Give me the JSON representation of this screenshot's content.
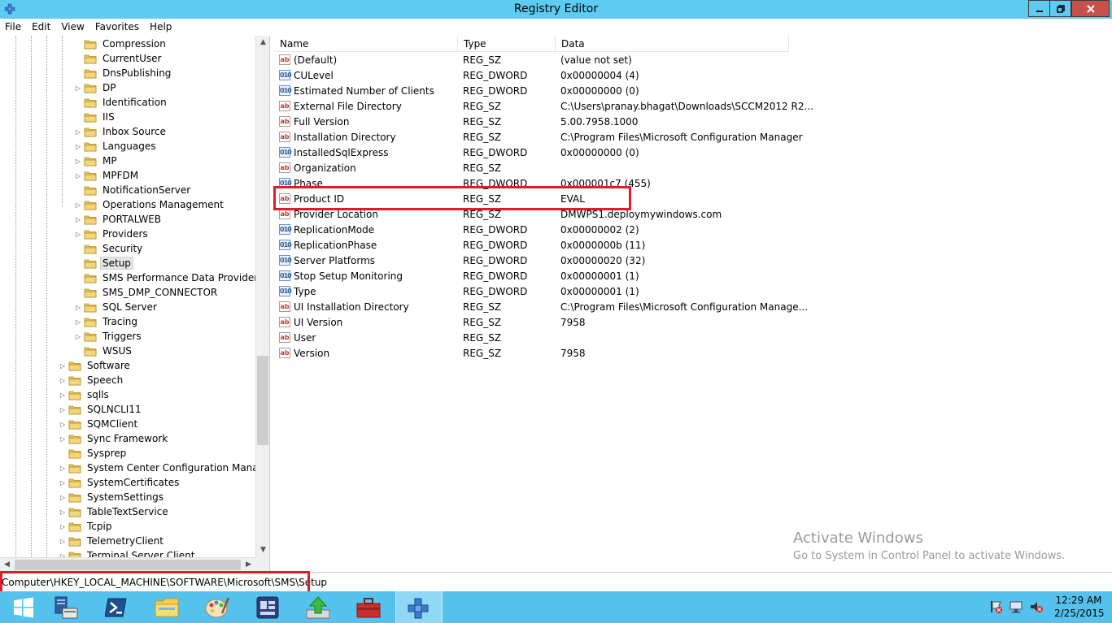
{
  "window": {
    "title": "Registry Editor",
    "buttons": {
      "minimize": "minimize-icon",
      "maximize": "restore-icon",
      "close": "close-icon"
    }
  },
  "menu": [
    "File",
    "Edit",
    "View",
    "Favorites",
    "Help"
  ],
  "tree": {
    "rows": [
      {
        "label": "Compression",
        "level": 2,
        "arrow": false,
        "selected": false
      },
      {
        "label": "CurrentUser",
        "level": 2,
        "arrow": false,
        "selected": false
      },
      {
        "label": "DnsPublishing",
        "level": 2,
        "arrow": false,
        "selected": false
      },
      {
        "label": "DP",
        "level": 2,
        "arrow": true,
        "selected": false
      },
      {
        "label": "Identification",
        "level": 2,
        "arrow": false,
        "selected": false
      },
      {
        "label": "IIS",
        "level": 2,
        "arrow": false,
        "selected": false
      },
      {
        "label": "Inbox Source",
        "level": 2,
        "arrow": true,
        "selected": false
      },
      {
        "label": "Languages",
        "level": 2,
        "arrow": true,
        "selected": false
      },
      {
        "label": "MP",
        "level": 2,
        "arrow": true,
        "selected": false
      },
      {
        "label": "MPFDM",
        "level": 2,
        "arrow": true,
        "selected": false
      },
      {
        "label": "NotificationServer",
        "level": 2,
        "arrow": false,
        "selected": false
      },
      {
        "label": "Operations Management",
        "level": 2,
        "arrow": true,
        "selected": false
      },
      {
        "label": "PORTALWEB",
        "level": 2,
        "arrow": true,
        "selected": false
      },
      {
        "label": "Providers",
        "level": 2,
        "arrow": true,
        "selected": false
      },
      {
        "label": "Security",
        "level": 2,
        "arrow": false,
        "selected": false
      },
      {
        "label": "Setup",
        "level": 2,
        "arrow": false,
        "selected": true
      },
      {
        "label": "SMS Performance Data Provider",
        "level": 2,
        "arrow": false,
        "selected": false
      },
      {
        "label": "SMS_DMP_CONNECTOR",
        "level": 2,
        "arrow": false,
        "selected": false
      },
      {
        "label": "SQL Server",
        "level": 2,
        "arrow": true,
        "selected": false
      },
      {
        "label": "Tracing",
        "level": 2,
        "arrow": true,
        "selected": false
      },
      {
        "label": "Triggers",
        "level": 2,
        "arrow": true,
        "selected": false
      },
      {
        "label": "WSUS",
        "level": 2,
        "arrow": false,
        "selected": false
      },
      {
        "label": "Software",
        "level": 1,
        "arrow": true,
        "selected": false
      },
      {
        "label": "Speech",
        "level": 1,
        "arrow": true,
        "selected": false
      },
      {
        "label": "sqlls",
        "level": 1,
        "arrow": true,
        "selected": false
      },
      {
        "label": "SQLNCLI11",
        "level": 1,
        "arrow": true,
        "selected": false
      },
      {
        "label": "SQMClient",
        "level": 1,
        "arrow": true,
        "selected": false
      },
      {
        "label": "Sync Framework",
        "level": 1,
        "arrow": true,
        "selected": false
      },
      {
        "label": "Sysprep",
        "level": 1,
        "arrow": false,
        "selected": false
      },
      {
        "label": "System Center Configuration Manager",
        "level": 1,
        "arrow": true,
        "selected": false
      },
      {
        "label": "SystemCertificates",
        "level": 1,
        "arrow": true,
        "selected": false
      },
      {
        "label": "SystemSettings",
        "level": 1,
        "arrow": true,
        "selected": false
      },
      {
        "label": "TableTextService",
        "level": 1,
        "arrow": true,
        "selected": false
      },
      {
        "label": "Tcpip",
        "level": 1,
        "arrow": true,
        "selected": false
      },
      {
        "label": "TelemetryClient",
        "level": 1,
        "arrow": true,
        "selected": false
      },
      {
        "label": "Terminal Server Client",
        "level": 1,
        "arrow": true,
        "selected": false
      }
    ]
  },
  "list": {
    "columns": [
      "Name",
      "Type",
      "Data"
    ],
    "rows": [
      {
        "name": "(Default)",
        "type": "REG_SZ",
        "data": "(value not set)",
        "kind": "sz"
      },
      {
        "name": "CULevel",
        "type": "REG_DWORD",
        "data": "0x00000004 (4)",
        "kind": "dword"
      },
      {
        "name": "Estimated Number of Clients",
        "type": "REG_DWORD",
        "data": "0x00000000 (0)",
        "kind": "dword"
      },
      {
        "name": "External File Directory",
        "type": "REG_SZ",
        "data": "C:\\Users\\pranay.bhagat\\Downloads\\SCCM2012 R2...",
        "kind": "sz"
      },
      {
        "name": "Full Version",
        "type": "REG_SZ",
        "data": "5.00.7958.1000",
        "kind": "sz"
      },
      {
        "name": "Installation Directory",
        "type": "REG_SZ",
        "data": "C:\\Program Files\\Microsoft Configuration Manager",
        "kind": "sz"
      },
      {
        "name": "InstalledSqlExpress",
        "type": "REG_DWORD",
        "data": "0x00000000 (0)",
        "kind": "dword"
      },
      {
        "name": "Organization",
        "type": "REG_SZ",
        "data": "",
        "kind": "sz"
      },
      {
        "name": "Phase",
        "type": "REG_DWORD",
        "data": "0x000001c7 (455)",
        "kind": "dword"
      },
      {
        "name": "Product ID",
        "type": "REG_SZ",
        "data": "EVAL",
        "kind": "sz"
      },
      {
        "name": "Provider Location",
        "type": "REG_SZ",
        "data": "DMWPS1.deploymywindows.com",
        "kind": "sz"
      },
      {
        "name": "ReplicationMode",
        "type": "REG_DWORD",
        "data": "0x00000002 (2)",
        "kind": "dword"
      },
      {
        "name": "ReplicationPhase",
        "type": "REG_DWORD",
        "data": "0x0000000b (11)",
        "kind": "dword"
      },
      {
        "name": "Server Platforms",
        "type": "REG_DWORD",
        "data": "0x00000020 (32)",
        "kind": "dword"
      },
      {
        "name": "Stop Setup Monitoring",
        "type": "REG_DWORD",
        "data": "0x00000001 (1)",
        "kind": "dword"
      },
      {
        "name": "Type",
        "type": "REG_DWORD",
        "data": "0x00000001 (1)",
        "kind": "dword"
      },
      {
        "name": "UI Installation Directory",
        "type": "REG_SZ",
        "data": "C:\\Program Files\\Microsoft Configuration Manage...",
        "kind": "sz"
      },
      {
        "name": "UI Version",
        "type": "REG_SZ",
        "data": "7958",
        "kind": "sz"
      },
      {
        "name": "User",
        "type": "REG_SZ",
        "data": "",
        "kind": "sz"
      },
      {
        "name": "Version",
        "type": "REG_SZ",
        "data": "7958",
        "kind": "sz"
      }
    ]
  },
  "icon_labels": {
    "sz": "ab",
    "dword": "010"
  },
  "watermark": {
    "title": "Activate Windows",
    "subtitle": "Go to System in Control Panel to activate Windows."
  },
  "status": {
    "path": "Computer\\HKEY_LOCAL_MACHINE\\SOFTWARE\\Microsoft\\SMS\\Setup"
  },
  "taskbar": {
    "apps": [
      "start-icon",
      "server-manager-icon",
      "powershell-icon",
      "file-explorer-icon",
      "paint-icon",
      "configmgr-console-icon",
      "upload-icon",
      "toolbox-icon",
      "registry-editor-icon"
    ],
    "clock": {
      "time": "12:29 AM",
      "date": "2/25/2015"
    }
  },
  "colors": {
    "accent": "#5ecbf0",
    "taskbar": "#54c2ec",
    "highlight": "#e21b2a",
    "close": "#c7504b"
  }
}
